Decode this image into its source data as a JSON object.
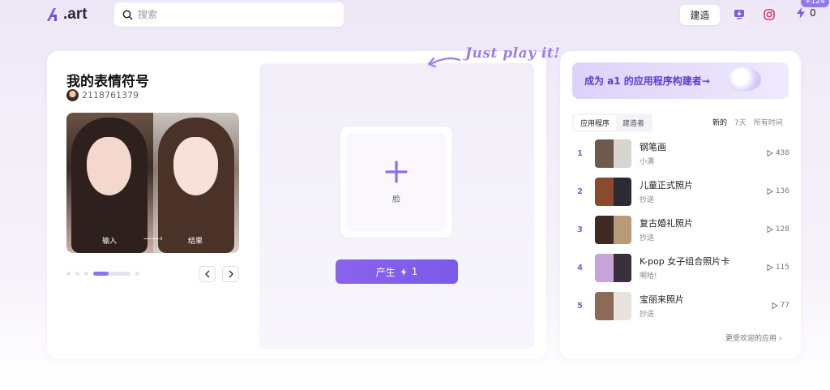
{
  "header": {
    "logo_text": ".art",
    "search_placeholder": "搜索",
    "build_label": "建造",
    "credits": "0",
    "credit_badge": "+124"
  },
  "app": {
    "title": "我的表情符号",
    "author": "2118761379",
    "input_label": "输入",
    "arrow": "——›",
    "result_label": "结果",
    "upload_label": "脸",
    "generate_label": "产生",
    "generate_cost": "1",
    "tagline": "Just play it!"
  },
  "sidebar": {
    "banner": "成为 a1 的应用程序构建者→",
    "tabs": [
      "应用程序",
      "建造者"
    ],
    "filters": [
      "新的",
      "7天",
      "所有时间"
    ],
    "items": [
      {
        "rank": "1",
        "name": "钢笔画",
        "sub": "小满",
        "plays": "438",
        "thumb": [
          "#6e5a4a",
          "#d8d4cf"
        ]
      },
      {
        "rank": "2",
        "name": "儿童正式照片",
        "sub": "抄送",
        "plays": "136",
        "thumb": [
          "#8a4a2c",
          "#2c2a33"
        ]
      },
      {
        "rank": "3",
        "name": "复古婚礼照片",
        "sub": "抄送",
        "plays": "128",
        "thumb": [
          "#3d2a22",
          "#b79a78"
        ]
      },
      {
        "rank": "4",
        "name": "K-pop 女子组合照片卡",
        "sub": "啊哈!",
        "plays": "115",
        "thumb": [
          "#c6a4d8",
          "#3a2f3c"
        ]
      },
      {
        "rank": "5",
        "name": "宝丽来照片",
        "sub": "抄送",
        "plays": "77",
        "thumb": [
          "#8c6a55",
          "#e8e3dc"
        ]
      }
    ],
    "more_link": "更受欢迎的应用 ›"
  },
  "colors": {
    "accent": "#8a63ee",
    "rank": "#7c65d8"
  }
}
